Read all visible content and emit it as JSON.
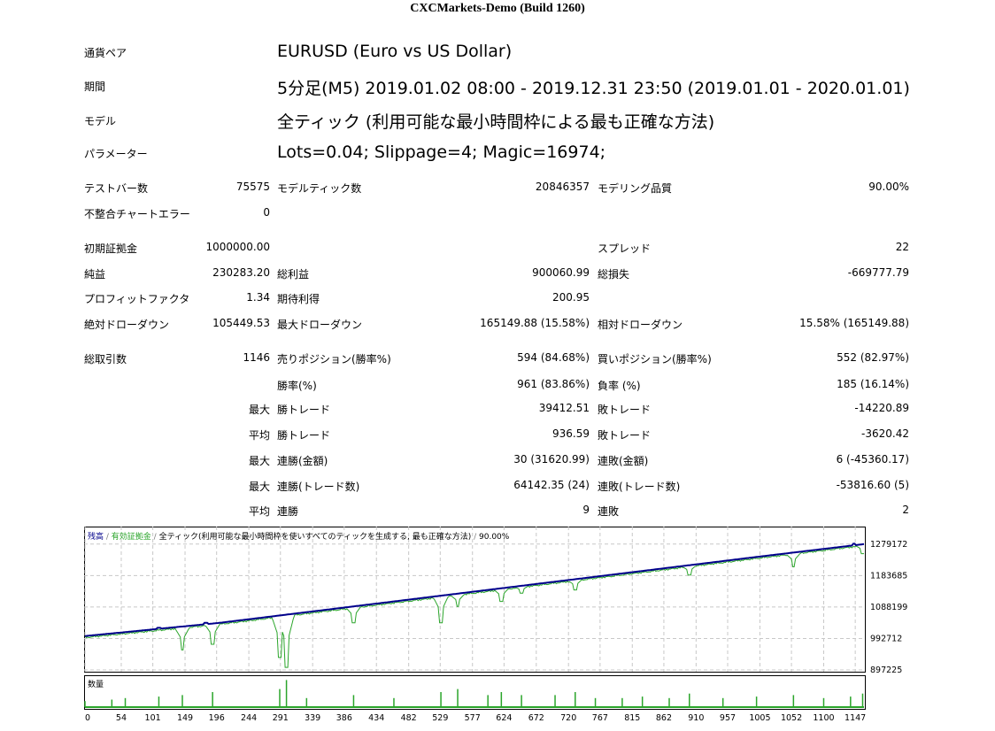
{
  "report": {
    "title": "CXCMarkets-Demo (Build 1260)"
  },
  "header_rows": [
    {
      "label": "通貨ペア",
      "value": "EURUSD (Euro vs US Dollar)"
    },
    {
      "label": "期間",
      "value": "5分足(M5) 2019.01.02 08:00 - 2019.12.31 23:50 (2019.01.01 - 2020.01.01)"
    },
    {
      "label": "モデル",
      "value": "全ティック (利用可能な最小時間枠による最も正確な方法)"
    },
    {
      "label": "パラメーター",
      "value": "Lots=0.04; Slippage=4; Magic=16974;"
    }
  ],
  "stats": {
    "bars_label": "テストバー数",
    "bars_value": "75575",
    "ticks_label": "モデルティック数",
    "ticks_value": "20846357",
    "quality_label": "モデリング品質",
    "quality_value": "90.00%",
    "mismatch_label": "不整合チャートエラー",
    "mismatch_value": "0",
    "deposit_label": "初期証拠金",
    "deposit_value": "1000000.00",
    "spread_label": "スプレッド",
    "spread_value": "22",
    "net_label": "純益",
    "net_value": "230283.20",
    "gross_profit_label": "総利益",
    "gross_profit_value": "900060.99",
    "gross_loss_label": "総損失",
    "gross_loss_value": "-669777.79",
    "pf_label": "プロフィットファクタ",
    "pf_value": "1.34",
    "expected_label": "期待利得",
    "expected_value": "200.95",
    "abs_dd_label": "絶対ドローダウン",
    "abs_dd_value": "105449.53",
    "max_dd_label": "最大ドローダウン",
    "max_dd_value": "165149.88 (15.58%)",
    "rel_dd_label": "相対ドローダウン",
    "rel_dd_value": "15.58% (165149.88)",
    "total_trades_label": "総取引数",
    "total_trades_value": "1146",
    "short_label": "売りポジション(勝率%)",
    "short_value": "594 (84.68%)",
    "long_label": "買いポジション(勝率%)",
    "long_value": "552 (82.97%)",
    "win_rate_label": "勝率(%)",
    "win_rate_value": "961 (83.86%)",
    "loss_rate_label": "負率 (%)",
    "loss_rate_value": "185 (16.14%)",
    "largest_label": "最大",
    "largest_win_label": "勝トレード",
    "largest_win_value": "39412.51",
    "largest_loss_label": "敗トレード",
    "largest_loss_value": "-14220.89",
    "average_label": "平均",
    "average_win_label": "勝トレード",
    "average_win_value": "936.59",
    "average_loss_label": "敗トレード",
    "average_loss_value": "-3620.42",
    "max_consec_label": "最大",
    "consec_wins_money_label": "連勝(金額)",
    "consec_wins_money_value": "30 (31620.99)",
    "consec_losses_money_label": "連敗(金額)",
    "consec_losses_money_value": "6 (-45360.17)",
    "max_consec2_label": "最大",
    "consec_profit_label": "連勝(トレード数)",
    "consec_profit_value": "64142.35 (24)",
    "consec_loss_label": "連敗(トレード数)",
    "consec_loss_value": "-53816.60 (5)",
    "avg_consec_label": "平均",
    "avg_consec_wins_label": "連勝",
    "avg_consec_wins_value": "9",
    "avg_consec_losses_label": "連敗",
    "avg_consec_losses_value": "2"
  },
  "chart_data": {
    "type": "line",
    "legend": {
      "balance": "残高",
      "sep1": " / ",
      "equity": "有効証拠金",
      "sep2": " / ",
      "model": "全ティック(利用可能な最小時間枠を使いすべてのティックを生成する, 最も正確な方法)",
      "sep3": " / ",
      "quality": "90.00%"
    },
    "y_ticks": [
      "1279172",
      "1183685",
      "1088199",
      "992712",
      "897225"
    ],
    "y_tick_values": [
      1279172,
      1183685,
      1088199,
      992712,
      897225
    ],
    "ylim": [
      897225,
      1300000
    ],
    "x_ticks": [
      "0",
      "54",
      "101",
      "149",
      "196",
      "244",
      "291",
      "339",
      "386",
      "434",
      "482",
      "529",
      "577",
      "624",
      "672",
      "720",
      "767",
      "815",
      "862",
      "910",
      "957",
      "1005",
      "1052",
      "1100",
      "1147"
    ],
    "x_tick_values": [
      0,
      54,
      101,
      149,
      196,
      244,
      291,
      339,
      386,
      434,
      482,
      529,
      577,
      624,
      672,
      720,
      767,
      815,
      862,
      910,
      957,
      1005,
      1052,
      1100,
      1147
    ],
    "xlim": [
      0,
      1160
    ],
    "balance": {
      "x": [
        0,
        200,
        400,
        600,
        800,
        1000,
        1160
      ],
      "y": [
        1000000,
        1040000,
        1090000,
        1140000,
        1190000,
        1240000,
        1279000
      ]
    },
    "balance_spikes": [
      [
        110,
        1025000
      ],
      [
        135,
        1026000
      ],
      [
        180,
        1040000
      ],
      [
        290,
        1060000
      ],
      [
        720,
        1165000
      ],
      [
        750,
        1172000
      ],
      [
        915,
        1215000
      ],
      [
        1060,
        1240000
      ],
      [
        1145,
        1280000
      ]
    ],
    "equity_dips": [
      [
        145,
        958000
      ],
      [
        190,
        975000
      ],
      [
        290,
        935000
      ],
      [
        300,
        905000
      ],
      [
        400,
        1040000
      ],
      [
        530,
        1040000
      ],
      [
        555,
        1090000
      ],
      [
        620,
        1105000
      ],
      [
        650,
        1130000
      ],
      [
        730,
        1140000
      ],
      [
        900,
        1185000
      ],
      [
        1055,
        1210000
      ],
      [
        1158,
        1250000
      ]
    ],
    "volume_label": "数量",
    "volume_spikes": [
      [
        0,
        0.2
      ],
      [
        40,
        0.25
      ],
      [
        60,
        0.3
      ],
      [
        110,
        0.35
      ],
      [
        145,
        0.4
      ],
      [
        190,
        0.5
      ],
      [
        290,
        0.6
      ],
      [
        300,
        0.9
      ],
      [
        330,
        0.3
      ],
      [
        400,
        0.4
      ],
      [
        460,
        0.3
      ],
      [
        530,
        0.5
      ],
      [
        555,
        0.6
      ],
      [
        600,
        0.4
      ],
      [
        620,
        0.5
      ],
      [
        650,
        0.4
      ],
      [
        700,
        0.4
      ],
      [
        730,
        0.5
      ],
      [
        760,
        0.3
      ],
      [
        800,
        0.3
      ],
      [
        830,
        0.35
      ],
      [
        870,
        0.3
      ],
      [
        900,
        0.45
      ],
      [
        950,
        0.3
      ],
      [
        1000,
        0.35
      ],
      [
        1055,
        0.4
      ],
      [
        1100,
        0.3
      ],
      [
        1140,
        0.35
      ],
      [
        1158,
        0.45
      ]
    ],
    "colors": {
      "balance": "#00008b",
      "equity": "#2aa52a",
      "grid": "#c8c8c8",
      "legend_sep": "#808080"
    }
  }
}
